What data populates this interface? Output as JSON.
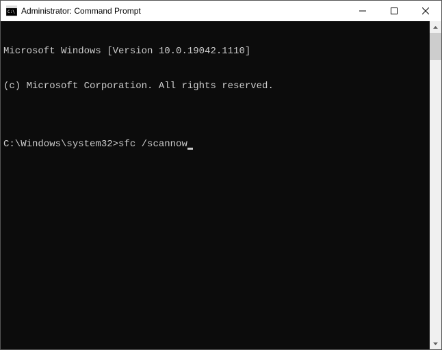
{
  "window": {
    "title": "Administrator: Command Prompt"
  },
  "terminal": {
    "line1": "Microsoft Windows [Version 10.0.19042.1110]",
    "line2": "(c) Microsoft Corporation. All rights reserved.",
    "blank": "",
    "prompt": "C:\\Windows\\system32>",
    "command": "sfc /scannow"
  }
}
